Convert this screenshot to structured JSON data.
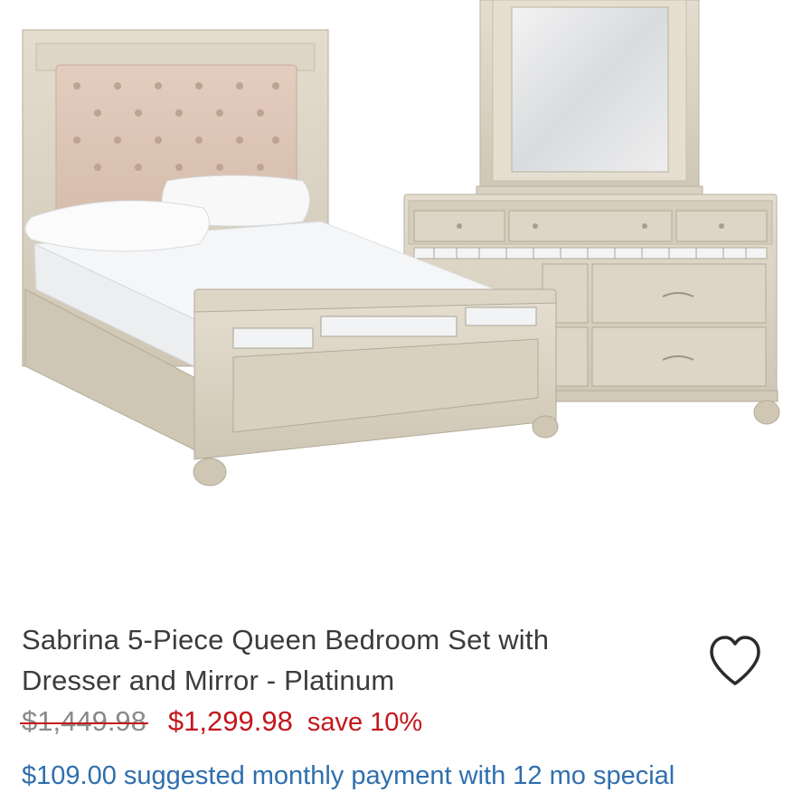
{
  "product": {
    "title": "Sabrina 5-Piece Queen Bedroom Set with Dresser and Mirror - Platinum",
    "original_price": "$1,449.98",
    "sale_price": "$1,299.98",
    "savings": "save 10%",
    "monthly_payment": "$109.00 suggested monthly payment with 12 mo special"
  },
  "icons": {
    "favorite": "heart-outline-icon"
  },
  "colors": {
    "title": "#3b3b3b",
    "original_price": "#8a8a8a",
    "sale": "#c4161c",
    "link": "#2f6fae",
    "furniture_finish": "#d8d0c0"
  }
}
